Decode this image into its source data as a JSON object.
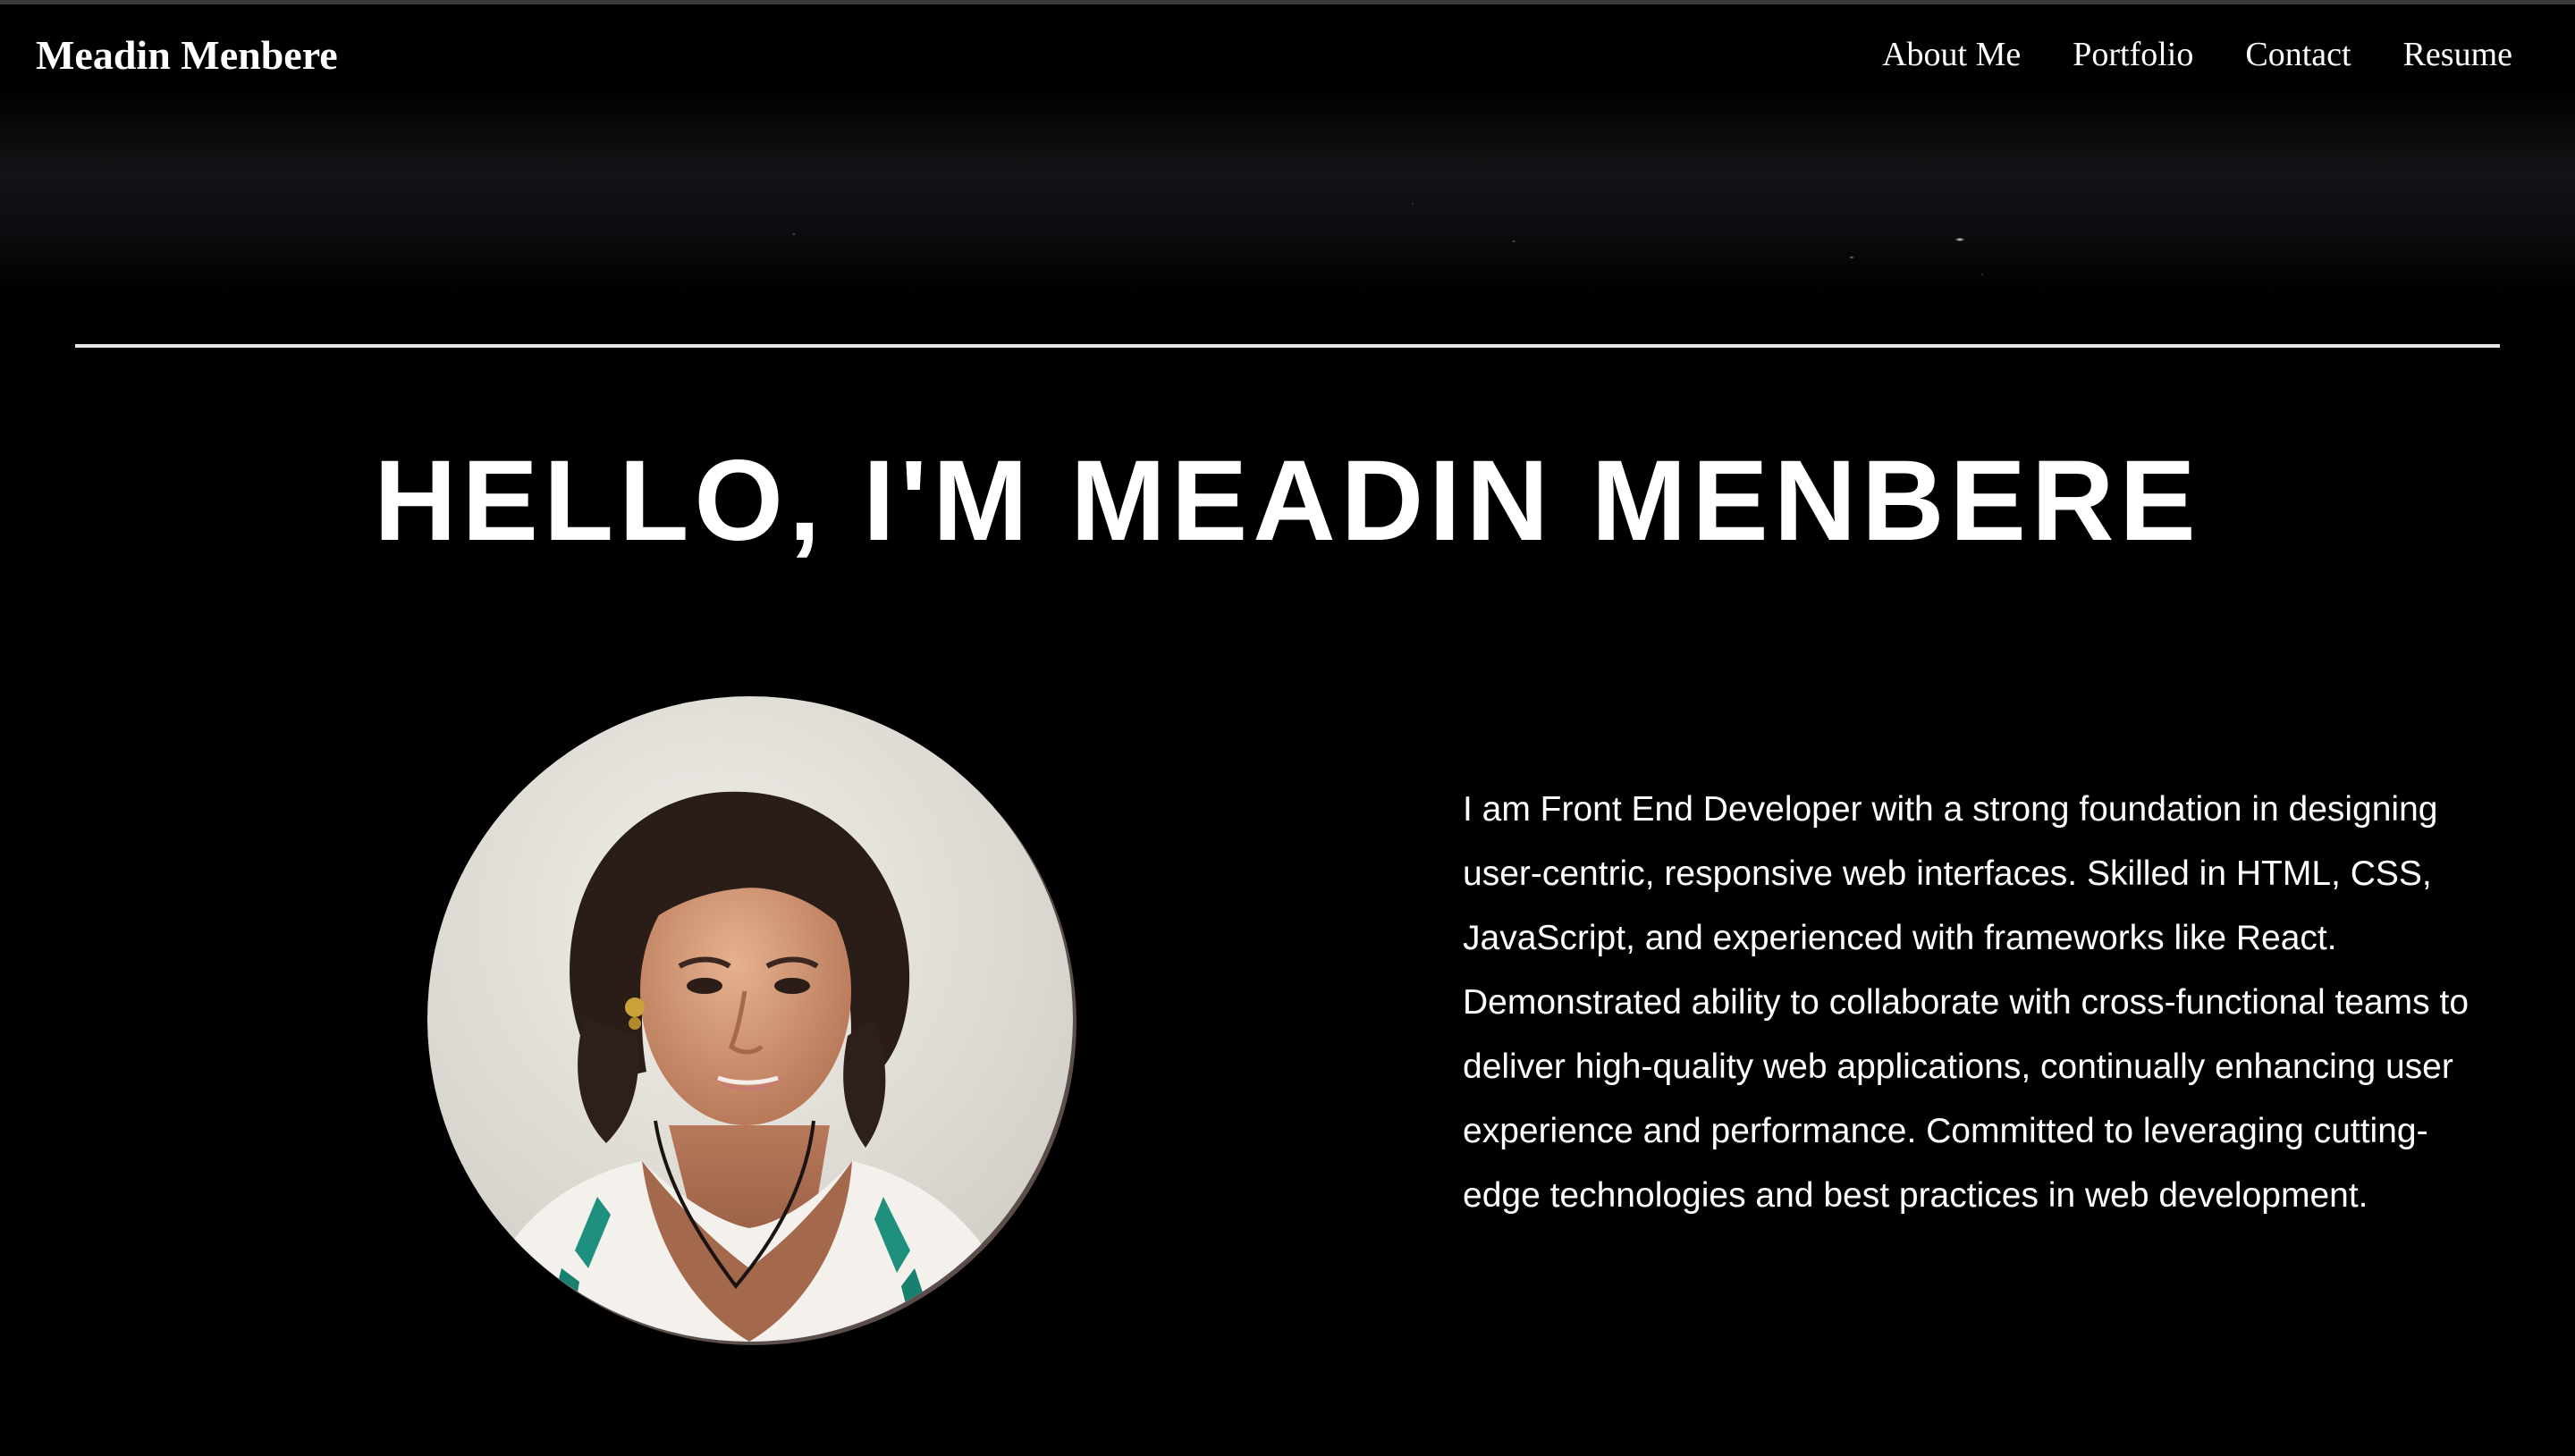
{
  "header": {
    "brand": "Meadin Menbere",
    "nav": [
      {
        "label": "About Me"
      },
      {
        "label": "Portfolio"
      },
      {
        "label": "Contact"
      },
      {
        "label": "Resume"
      }
    ]
  },
  "hero": {
    "title": "HELLO, I'M MEADIN MENBERE"
  },
  "about": {
    "bio": "I am Front End Developer with a strong foundation in designing user-centric, responsive web interfaces. Skilled in HTML, CSS, JavaScript, and experienced with frameworks like React. Demonstrated ability to collaborate with cross-functional teams to deliver high-quality web applications, continually enhancing user experience and performance. Committed to leveraging cutting-edge technologies and best practices in web development."
  },
  "colors": {
    "background": "#000000",
    "text": "#ffffff",
    "divider": "#e6e6e6"
  }
}
